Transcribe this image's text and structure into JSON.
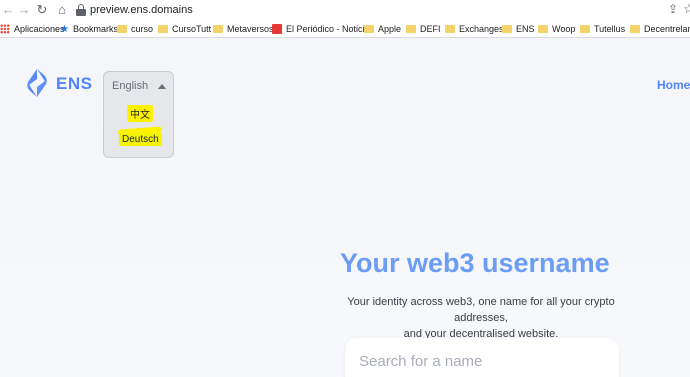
{
  "browser": {
    "url": "preview.ens.domains",
    "bookmarks": [
      {
        "label": "Aplicaciones",
        "icon": "apps-grid-icon"
      },
      {
        "label": "Bookmarks",
        "icon": "star-icon"
      },
      {
        "label": "curso",
        "icon": "folder-icon"
      },
      {
        "label": "CursoTutt",
        "icon": "folder-icon"
      },
      {
        "label": "Metaversos",
        "icon": "folder-icon"
      },
      {
        "label": "El Periódico - Notici...",
        "icon": "periodico-icon"
      },
      {
        "label": "Apple",
        "icon": "folder-icon"
      },
      {
        "label": "DEFI",
        "icon": "folder-icon"
      },
      {
        "label": "Exchanges",
        "icon": "folder-icon"
      },
      {
        "label": "ENS",
        "icon": "folder-icon"
      },
      {
        "label": "Woop",
        "icon": "folder-icon"
      },
      {
        "label": "Tutellus",
        "icon": "folder-icon"
      },
      {
        "label": "Decentreland",
        "icon": "folder-icon"
      }
    ]
  },
  "header": {
    "logo_text": "ENS",
    "language": {
      "current": "English",
      "options": [
        "中文",
        "Deutsch"
      ]
    },
    "nav_home": "Home"
  },
  "hero": {
    "title": "Your web3 username",
    "subtitle_line1": "Your identity across web3, one name for all your crypto addresses,",
    "subtitle_line2": "and your decentralised website."
  },
  "search": {
    "placeholder": "Search for a name"
  },
  "colors": {
    "brand": "#5284ff",
    "title": "#6b9cf6",
    "highlight": "#fff200"
  }
}
